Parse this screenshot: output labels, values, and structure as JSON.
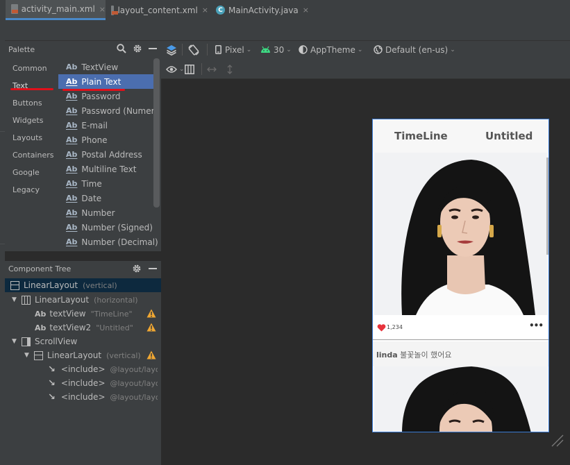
{
  "tabs": [
    {
      "label": "activity_main.xml",
      "type": "xml",
      "active": true
    },
    {
      "label": "layout_content.xml",
      "type": "xml",
      "active": false
    },
    {
      "label": "MainActivity.java",
      "type": "java",
      "active": false
    }
  ],
  "tab_close_glyph": "×",
  "java_icon_letter": "C",
  "palette": {
    "title": "Palette",
    "categories": [
      "Common",
      "Text",
      "Buttons",
      "Widgets",
      "Layouts",
      "Containers",
      "Google",
      "Legacy"
    ],
    "selected_category": "Text",
    "items": [
      {
        "icon": "Ab",
        "label": "TextView"
      },
      {
        "icon": "Ab",
        "label": "Plain Text"
      },
      {
        "icon": "Ab",
        "label": "Password"
      },
      {
        "icon": "Ab",
        "label": "Password (Numeric)"
      },
      {
        "icon": "Ab",
        "label": "E-mail"
      },
      {
        "icon": "Ab",
        "label": "Phone"
      },
      {
        "icon": "Ab",
        "label": "Postal Address"
      },
      {
        "icon": "Ab",
        "label": "Multiline Text"
      },
      {
        "icon": "Ab",
        "label": "Time"
      },
      {
        "icon": "Ab",
        "label": "Date"
      },
      {
        "icon": "Ab",
        "label": "Number"
      },
      {
        "icon": "Ab",
        "label": "Number (Signed)"
      },
      {
        "icon": "Ab",
        "label": "Number (Decimal)"
      }
    ],
    "selected_item": "Plain Text"
  },
  "component_tree": {
    "title": "Component Tree",
    "nodes": [
      {
        "label": "LinearLayout",
        "hint": "(vertical)"
      },
      {
        "label": "LinearLayout",
        "hint": "(horizontal)"
      },
      {
        "label": "textView",
        "hint": "\"TimeLine\""
      },
      {
        "label": "textView2",
        "hint": "\"Untitled\""
      },
      {
        "label": "ScrollView",
        "hint": ""
      },
      {
        "label": "LinearLayout",
        "hint": "(vertical)"
      },
      {
        "label": "<include>",
        "hint": "@layout/layout_content"
      },
      {
        "label": "<include>",
        "hint": "@layout/layout_content"
      },
      {
        "label": "<include>",
        "hint": "@layout/layout_content"
      }
    ]
  },
  "toolbar": {
    "device": "Pixel",
    "api": "30",
    "theme": "AppTheme",
    "locale": "Default (en-us)",
    "chevron": "⌄"
  },
  "phone": {
    "title_left": "TimeLine",
    "title_right": "Untitled",
    "likes": "1,234",
    "more": "•••",
    "caption_user": "linda",
    "caption_text": "불꽃놀이 했어요"
  },
  "colors": {
    "accent_blue": "#4b6eaf",
    "selection_dark": "#0d293e",
    "red_markup": "#e0101a",
    "warning": "#f0a732",
    "heart": "#e8333c",
    "android_green": "#3ddc84"
  }
}
